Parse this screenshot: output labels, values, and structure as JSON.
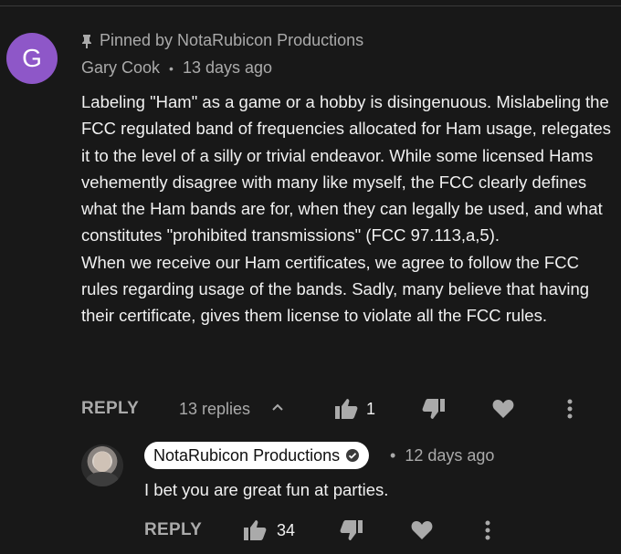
{
  "comment": {
    "avatar_letter": "G",
    "pinned_label": "Pinned by NotaRubicon Productions",
    "author": "Gary Cook",
    "time": "13 days ago",
    "paragraphs": [
      "Labeling \"Ham\" as a game or a hobby is disingenuous. Mislabeling the FCC regulated band of frequencies allocated for Ham usage, relegates it to the level of a silly or trivial endeavor. While some licensed Hams vehemently disagree with many like myself, the FCC clearly defines what the Ham bands are for, when they can legally be used, and what constitutes \"prohibited transmissions\" (FCC 97.113,a,5).",
      "When we receive our Ham certificates, we agree to follow the FCC rules regarding usage of the bands. Sadly, many believe that having their certificate, gives them license to violate all the FCC rules."
    ],
    "reply_label": "REPLY",
    "replies_label": "13 replies",
    "like_count": "1"
  },
  "reply": {
    "author": "NotaRubicon Productions",
    "time": "12 days ago",
    "text": "I bet you are great fun at parties.",
    "reply_label": "REPLY",
    "like_count": "34"
  },
  "icons": {
    "pin": "pin-icon",
    "like": "thumbs-up-icon",
    "dislike": "thumbs-down-icon",
    "heart": "heart-icon",
    "more": "more-vert-icon",
    "verified": "verified-check-icon"
  },
  "colors": {
    "background": "#181818",
    "avatar_purple": "#8e57c8",
    "text_secondary": "#aaaaaa",
    "text_primary": "#f1f1f1"
  }
}
